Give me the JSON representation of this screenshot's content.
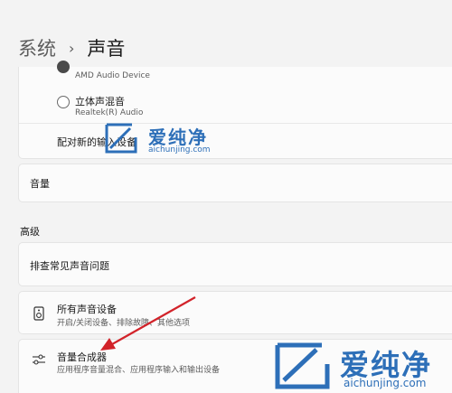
{
  "breadcrumb": {
    "parent": "系统",
    "separator": "›",
    "current": "声音"
  },
  "input_devices": {
    "items": [
      {
        "name": "",
        "sub": "AMD Audio Device",
        "selected": true
      },
      {
        "name": "立体声混音",
        "sub": "Realtek(R) Audio",
        "selected": false
      }
    ],
    "pair_label": "配对新的输入设备"
  },
  "volume": {
    "label": "音量"
  },
  "advanced": {
    "section_title": "高级",
    "troubleshoot_label": "排查常见声音问题",
    "all_devices": {
      "title": "所有声音设备",
      "description": "开启/关闭设备、排除故障、其他选项"
    },
    "volume_mixer": {
      "title": "音量合成器",
      "description": "应用程序音量混合、应用程序输入和输出设备"
    }
  },
  "watermark": {
    "brand": "爱纯净",
    "url": "aichunjing.com"
  },
  "icons": {
    "device": "speaker-device-icon",
    "mixer": "mixer-sliders-icon",
    "watermark_logo": "aichunjing-logo-icon"
  },
  "colors": {
    "arrow": "#d2232a",
    "watermark": "#2d6fb8"
  }
}
